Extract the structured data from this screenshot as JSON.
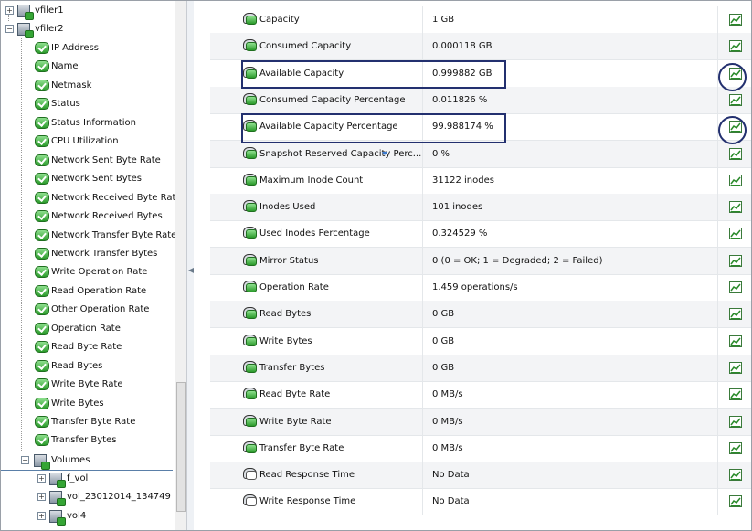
{
  "tree": {
    "root_items": [
      {
        "label": "vfiler1",
        "expander": "plus"
      },
      {
        "label": "vfiler2",
        "expander": "minus"
      }
    ],
    "vfiler2_children": [
      "IP Address",
      "Name",
      "Netmask",
      "Status",
      "Status Information",
      "CPU Utilization",
      "Network Sent Byte Rate",
      "Network Sent Bytes",
      "Network Received Byte Rate",
      "Network Received Bytes",
      "Network Transfer Byte Rate",
      "Network Transfer Bytes",
      "Write Operation Rate",
      "Read Operation Rate",
      "Other Operation Rate",
      "Operation Rate",
      "Read Byte Rate",
      "Read Bytes",
      "Write Byte Rate",
      "Write Bytes",
      "Transfer Byte Rate",
      "Transfer Bytes"
    ],
    "volumes": {
      "label": "Volumes",
      "expander": "minus"
    },
    "volume_children": [
      {
        "label": "f_vol",
        "expander": "plus"
      },
      {
        "label": "vol_23012014_134749",
        "expander": "plus"
      },
      {
        "label": "vol4",
        "expander": "plus"
      }
    ]
  },
  "table": {
    "rows": [
      {
        "name": "Capacity",
        "value": "1 GB",
        "icon": "monitor-ok-icon"
      },
      {
        "name": "Consumed Capacity",
        "value": "0.000118 GB",
        "icon": "monitor-ok-icon"
      },
      {
        "name": "Available Capacity",
        "value": "0.999882 GB",
        "icon": "monitor-ok-icon"
      },
      {
        "name": "Consumed Capacity Percentage",
        "value": "0.011826 %",
        "icon": "monitor-ok-icon"
      },
      {
        "name": "Available Capacity Percentage",
        "value": "99.988174 %",
        "icon": "monitor-ok-icon"
      },
      {
        "name": "Snapshot Reserved Capacity Perc...",
        "value": "0 %",
        "icon": "monitor-ok-icon"
      },
      {
        "name": "Maximum Inode Count",
        "value": "31122 inodes",
        "icon": "monitor-ok-icon"
      },
      {
        "name": "Inodes Used",
        "value": "101 inodes",
        "icon": "monitor-ok-icon"
      },
      {
        "name": "Used Inodes Percentage",
        "value": "0.324529 %",
        "icon": "monitor-ok-icon"
      },
      {
        "name": "Mirror Status",
        "value": "0 (0 = OK; 1 = Degraded; 2 = Failed)",
        "icon": "monitor-ok-icon"
      },
      {
        "name": "Operation Rate",
        "value": "1.459 operations/s",
        "icon": "monitor-ok-icon"
      },
      {
        "name": "Read Bytes",
        "value": "0 GB",
        "icon": "monitor-ok-icon"
      },
      {
        "name": "Write Bytes",
        "value": "0 GB",
        "icon": "monitor-ok-icon"
      },
      {
        "name": "Transfer Bytes",
        "value": "0 GB",
        "icon": "monitor-ok-icon"
      },
      {
        "name": "Read Byte Rate",
        "value": "0 MB/s",
        "icon": "monitor-ok-icon"
      },
      {
        "name": "Write Byte Rate",
        "value": "0 MB/s",
        "icon": "monitor-ok-icon"
      },
      {
        "name": "Transfer Byte Rate",
        "value": "0 MB/s",
        "icon": "monitor-ok-icon"
      },
      {
        "name": "Read Response Time",
        "value": "No Data",
        "icon": "monitor-nodata-icon"
      },
      {
        "name": "Write Response Time",
        "value": "No Data",
        "icon": "monitor-nodata-icon"
      }
    ],
    "highlighted_rows": [
      "Available Capacity",
      "Available Capacity Percentage"
    ]
  },
  "colors": {
    "highlight_box": "#23306f",
    "status_green": "#2a9a2a",
    "row_alt": "#f3f4f6"
  }
}
